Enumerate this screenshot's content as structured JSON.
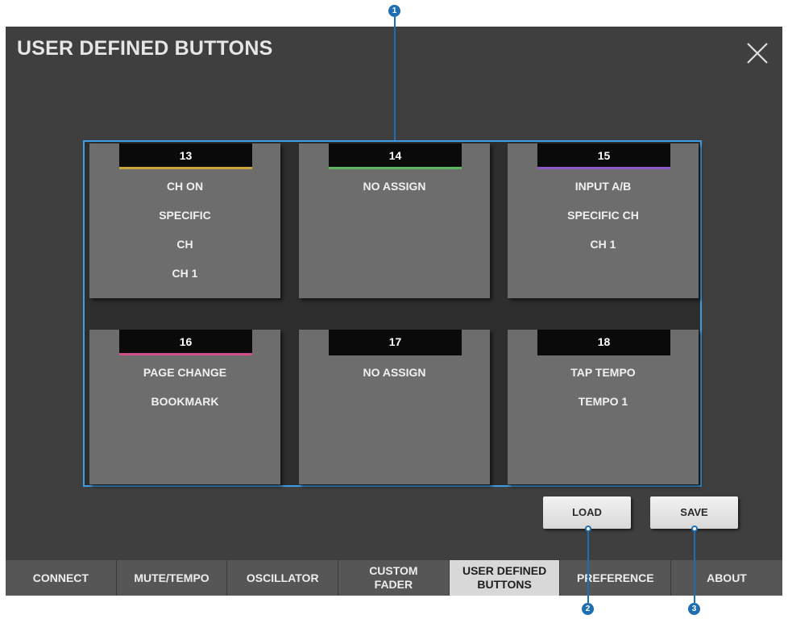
{
  "dialog": {
    "title": "USER DEFINED BUTTONS",
    "close_icon": "close-icon"
  },
  "user_buttons": [
    {
      "number": "13",
      "color": "#c9a43a",
      "lines": [
        "CH ON",
        "SPECIFIC",
        "CH",
        "CH 1"
      ]
    },
    {
      "number": "14",
      "color": "#5cb65c",
      "lines": [
        "NO ASSIGN"
      ]
    },
    {
      "number": "15",
      "color": "#8a5bc4",
      "lines": [
        "INPUT A/B",
        "SPECIFIC CH",
        "CH 1"
      ]
    },
    {
      "number": "16",
      "color": "#d0508a",
      "lines": [
        "PAGE CHANGE",
        "BOOKMARK"
      ]
    },
    {
      "number": "17",
      "color": "",
      "lines": [
        "NO ASSIGN"
      ]
    },
    {
      "number": "18",
      "color": "",
      "lines": [
        "TAP TEMPO",
        "TEMPO 1"
      ]
    }
  ],
  "actions": {
    "load_label": "LOAD",
    "save_label": "SAVE"
  },
  "tabs": [
    {
      "label": "CONNECT",
      "active": false
    },
    {
      "label": "MUTE/TEMPO",
      "active": false
    },
    {
      "label": "OSCILLATOR",
      "active": false
    },
    {
      "label": "CUSTOM\nFADER",
      "active": false
    },
    {
      "label": "USER DEFINED\nBUTTONS",
      "active": true
    },
    {
      "label": "PREFERENCE",
      "active": false
    },
    {
      "label": "ABOUT",
      "active": false
    }
  ],
  "callouts": {
    "one": "1",
    "two": "2",
    "three": "3"
  },
  "colors": {
    "panel_background": "#3f3f3f",
    "button_face": "#6d6d6d",
    "callout_blue": "#1f6fb0",
    "selection_frame": "#3d9ee6"
  }
}
